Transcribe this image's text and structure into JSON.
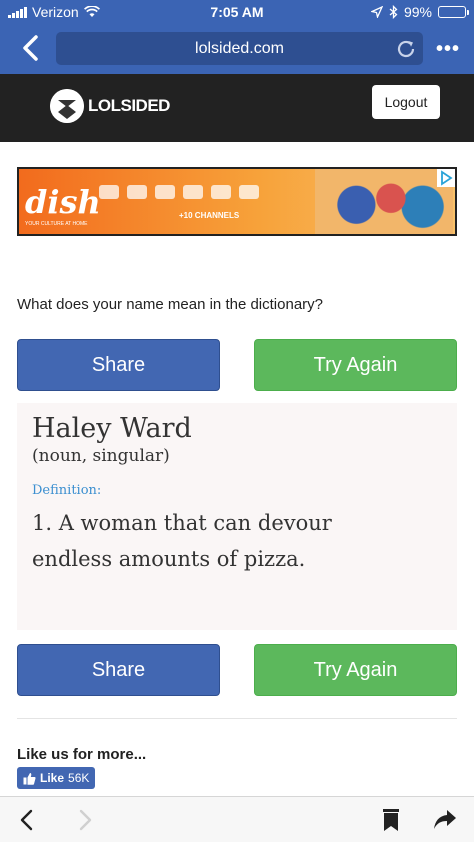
{
  "status": {
    "carrier": "Verizon",
    "time": "7:05 AM",
    "battery": "99%",
    "battery_level": 0.99
  },
  "browser": {
    "url": "lolsided.com",
    "more_label": "•••"
  },
  "site": {
    "logo_text": "LOLSIDED",
    "logout_label": "Logout"
  },
  "ad": {
    "brand": "dish",
    "tagline": "YOUR CULTURE AT HOME",
    "channels": "+10 CHANNELS"
  },
  "quiz": {
    "question": "What does your name mean in the dictionary?"
  },
  "buttons": {
    "share": "Share",
    "try_again": "Try Again"
  },
  "result": {
    "name": "Haley Ward",
    "part_of_speech": "(noun, singular)",
    "definition_label": "Definition:",
    "definition": "1. A woman that can devour endless amounts of pizza."
  },
  "social": {
    "like_heading": "Like us for more...",
    "like_label": "Like",
    "like_count": "56K"
  },
  "colors": {
    "browser_blue": "#3b64b4",
    "share_blue": "#4267b2",
    "try_green": "#5cb85c",
    "site_header": "#222222"
  }
}
